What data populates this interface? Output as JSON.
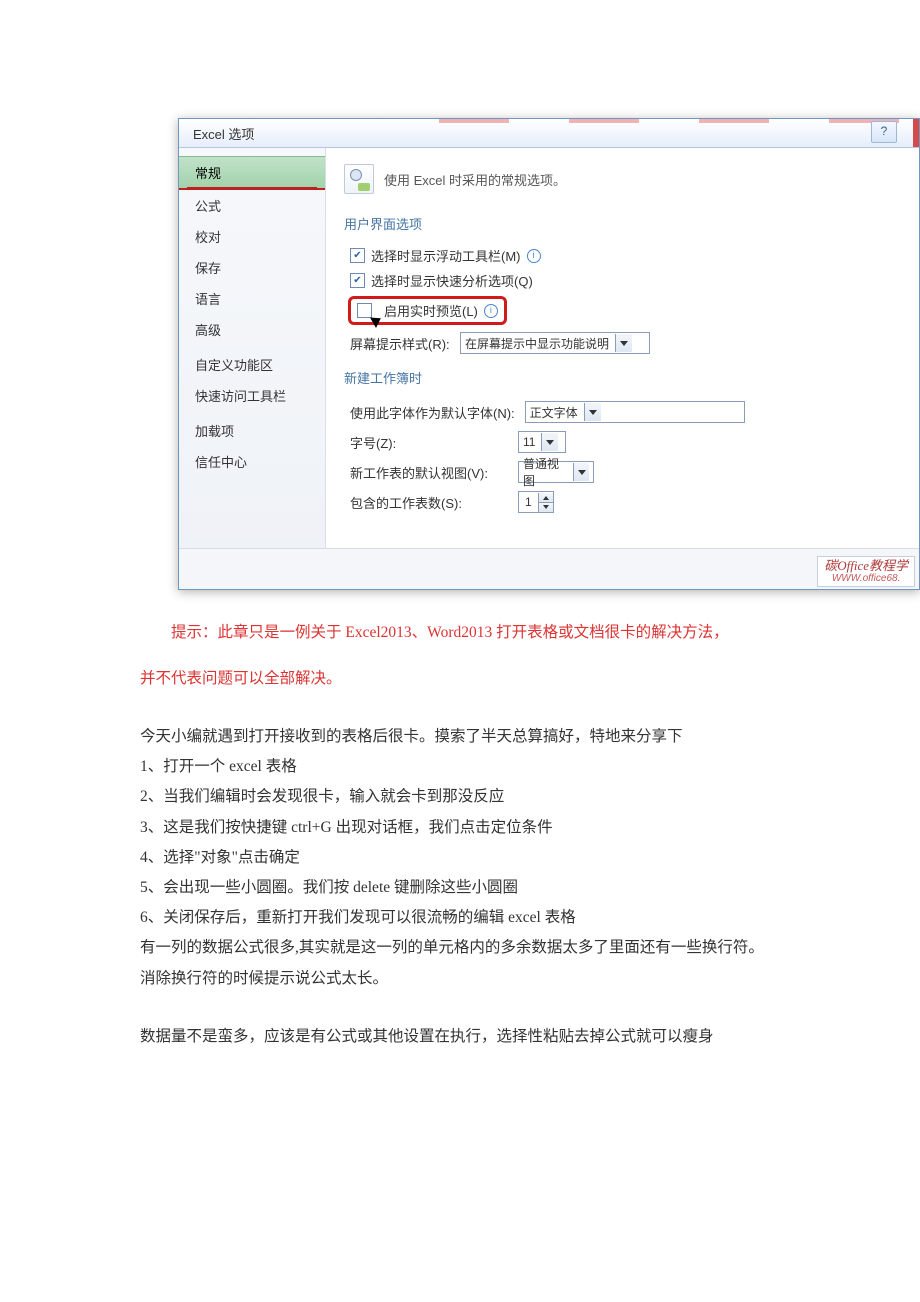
{
  "dialog": {
    "title": "Excel 选项",
    "help": "?",
    "sidebar": [
      "常规",
      "公式",
      "校对",
      "保存",
      "语言",
      "高级",
      "自定义功能区",
      "快速访问工具栏",
      "加载项",
      "信任中心"
    ],
    "headline_intro": "使用 Excel 时采用的常规选项。",
    "group_ui": "用户界面选项",
    "chk_float_toolbar": "选择时显示浮动工具栏(M)",
    "chk_quick_analysis": "选择时显示快速分析选项(Q)",
    "chk_live_preview": "启用实时预览(L)",
    "screentip_label": "屏幕提示样式(R):",
    "screentip_value": "在屏幕提示中显示功能说明",
    "group_new": "新建工作簿时",
    "font_label": "使用此字体作为默认字体(N):",
    "font_value": "正文字体",
    "size_label": "字号(Z):",
    "size_value": "11",
    "view_label": "新工作表的默认视图(V):",
    "view_value": "普通视图",
    "sheets_label": "包含的工作表数(S):",
    "sheets_value": "1",
    "watermark_l1": "碳Office教程学",
    "watermark_l2": "WWW.office68."
  },
  "article": {
    "tip_lead": "提示：",
    "tip_rest": "此章只是一例关于 Excel2013、Word2013 打开表格或文档很卡的解决方法，",
    "tip_line2": "并不代表问题可以全部解决。",
    "p_intro": "今天小编就遇到打开接收到的表格后很卡。摸索了半天总算搞好，特地来分享下",
    "p1": "1、打开一个 excel 表格",
    "p2": "2、当我们编辑时会发现很卡，输入就会卡到那没反应",
    "p3": "3、这是我们按快捷键 ctrl+G 出现对话框，我们点击定位条件",
    "p4": "4、选择\"对象\"点击确定",
    "p5": "5、会出现一些小圆圈。我们按 delete 键删除这些小圆圈",
    "p6": "6、关闭保存后，重新打开我们发现可以很流畅的编辑 excel 表格",
    "p_extra1": "有一列的数据公式很多,其实就是这一列的单元格内的多余数据太多了里面还有一些换行符。",
    "p_extra2": "消除换行符的时候提示说公式太长。",
    "p_last": "数据量不是蛮多，应该是有公式或其他设置在执行，选择性粘贴去掉公式就可以瘦身"
  }
}
